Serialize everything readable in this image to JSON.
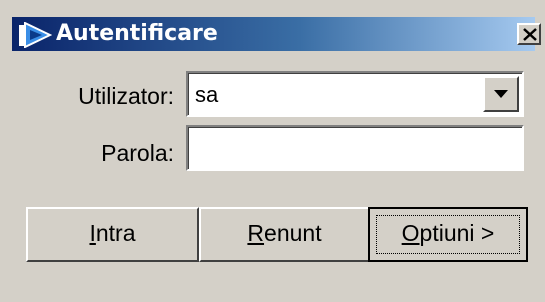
{
  "window": {
    "title": "Autentificare",
    "close_glyph": "X",
    "icon": "arrow-play-icon"
  },
  "form": {
    "user_label": "Utilizator:",
    "user_value": "sa",
    "password_label": "Parola:",
    "password_value": ""
  },
  "buttons": {
    "intra_mnemonic": "I",
    "intra_rest": "ntra",
    "renunt_mnemonic": "R",
    "renunt_rest": "enunt",
    "optiuni_mnemonic": "O",
    "optiuni_rest": "ptiuni >"
  },
  "colors": {
    "face": "#d4d0c8",
    "title_start": "#0a246a",
    "title_end": "#a6caf0",
    "field": "#ffffff"
  }
}
